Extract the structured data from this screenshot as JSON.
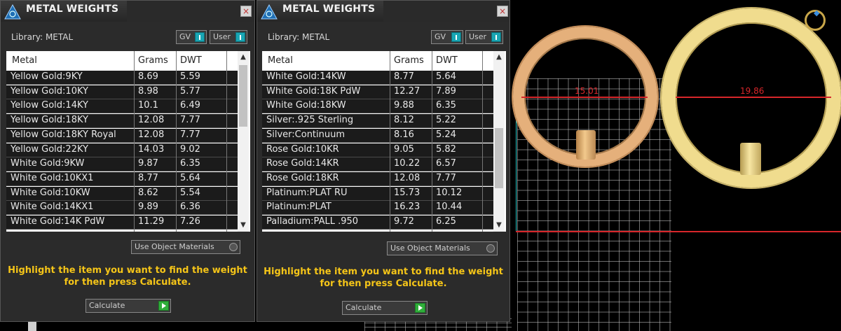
{
  "panels": [
    {
      "title": "METAL WEIGHTS",
      "close_glyph": "×",
      "library": "Library: METAL",
      "toggle_gv": "GV",
      "toggle_user": "User",
      "headers": {
        "metal": "Metal",
        "grams": "Grams",
        "dwt": "DWT"
      },
      "rows": [
        {
          "metal": "Yellow Gold:9KY",
          "grams": "8.69",
          "dwt": "5.59"
        },
        {
          "metal": "Yellow Gold:10KY",
          "grams": "8.98",
          "dwt": "5.77"
        },
        {
          "metal": "Yellow Gold:14KY",
          "grams": "10.1",
          "dwt": "6.49"
        },
        {
          "metal": "Yellow Gold:18KY",
          "grams": "12.08",
          "dwt": "7.77"
        },
        {
          "metal": "Yellow Gold:18KY Royal",
          "grams": "12.08",
          "dwt": "7.77"
        },
        {
          "metal": "Yellow Gold:22KY",
          "grams": "14.03",
          "dwt": "9.02"
        },
        {
          "metal": "White Gold:9KW",
          "grams": "9.87",
          "dwt": "6.35"
        },
        {
          "metal": "White Gold:10KX1",
          "grams": "8.77",
          "dwt": "5.64"
        },
        {
          "metal": "White Gold:10KW",
          "grams": "8.62",
          "dwt": "5.54"
        },
        {
          "metal": "White Gold:14KX1",
          "grams": "9.89",
          "dwt": "6.36"
        },
        {
          "metal": "White Gold:14K PdW",
          "grams": "11.29",
          "dwt": "7.26"
        }
      ],
      "use_object_materials": "Use Object Materials",
      "hint_line1": "Highlight the item you want to find the weight",
      "hint_line2": "for then press Calculate.",
      "calculate": "Calculate"
    },
    {
      "title": "METAL WEIGHTS",
      "close_glyph": "×",
      "library": "Library: METAL",
      "toggle_gv": "GV",
      "toggle_user": "User",
      "headers": {
        "metal": "Metal",
        "grams": "Grams",
        "dwt": "DWT"
      },
      "rows": [
        {
          "metal": "White Gold:14KW",
          "grams": "8.77",
          "dwt": "5.64"
        },
        {
          "metal": "White Gold:18K PdW",
          "grams": "12.27",
          "dwt": "7.89"
        },
        {
          "metal": "White Gold:18KW",
          "grams": "9.88",
          "dwt": "6.35"
        },
        {
          "metal": "Silver:.925 Sterling",
          "grams": "8.12",
          "dwt": "5.22"
        },
        {
          "metal": "Silver:Continuum",
          "grams": "8.16",
          "dwt": "5.24"
        },
        {
          "metal": "Rose Gold:10KR",
          "grams": "9.05",
          "dwt": "5.82"
        },
        {
          "metal": "Rose Gold:14KR",
          "grams": "10.22",
          "dwt": "6.57"
        },
        {
          "metal": "Rose Gold:18KR",
          "grams": "12.08",
          "dwt": "7.77"
        },
        {
          "metal": "Platinum:PLAT RU",
          "grams": "15.73",
          "dwt": "10.12"
        },
        {
          "metal": "Platinum:PLAT",
          "grams": "16.23",
          "dwt": "10.44"
        },
        {
          "metal": "Palladium:PALL .950",
          "grams": "9.72",
          "dwt": "6.25"
        }
      ],
      "use_object_materials": "Use Object Materials",
      "hint_line1": "Highlight the item you want to find the weight",
      "hint_line2": "for then press Calculate.",
      "calculate": "Calculate"
    }
  ],
  "viewport": {
    "ring1_dimension": "15.01",
    "ring2_dimension": "19.86",
    "ring1_color": "#e5b07b",
    "ring2_color": "#f0dc8e",
    "dimension_color": "#d7262a"
  }
}
